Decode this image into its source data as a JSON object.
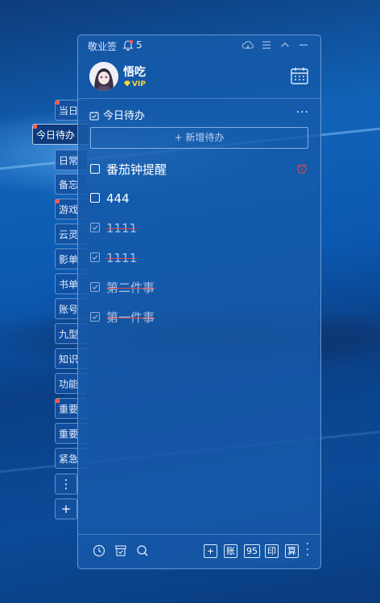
{
  "colors": {
    "accent": "#1f5fb0",
    "flag": "#ff5a4a",
    "strike": "#e0444b",
    "vip": "#ffd633"
  },
  "side_tabs": [
    {
      "label": "当日",
      "flag": true
    },
    {
      "label": "今日待办",
      "flag": true,
      "active": true
    },
    {
      "label": "日常",
      "flag": false
    },
    {
      "label": "备忘",
      "flag": false
    },
    {
      "label": "游戏",
      "flag": true
    },
    {
      "label": "云灵",
      "flag": false
    },
    {
      "label": "影单",
      "flag": false
    },
    {
      "label": "书单",
      "flag": false
    },
    {
      "label": "账号",
      "flag": false
    },
    {
      "label": "九型",
      "flag": false
    },
    {
      "label": "知识",
      "flag": false
    },
    {
      "label": "功能",
      "flag": false
    },
    {
      "label": "重要",
      "flag": true
    },
    {
      "label": "重要",
      "flag": false
    },
    {
      "label": "紧急",
      "flag": false
    }
  ],
  "side_buttons": {
    "more": "⋮",
    "add": "+"
  },
  "app": {
    "title": "敬业签",
    "notification_count": "5"
  },
  "titlebar_icons": [
    "cloud-sync-icon",
    "menu-icon",
    "collapse-icon",
    "minimize-icon"
  ],
  "user": {
    "name": "悟吃",
    "badge": "VIP"
  },
  "section": {
    "title": "今日待办",
    "more": "···"
  },
  "add_todo": {
    "label": "+ 新增待办"
  },
  "todos": [
    {
      "text": "番茄钟提醒",
      "done": false,
      "alarm": true
    },
    {
      "text": "444",
      "done": false,
      "alarm": false
    },
    {
      "text": "1111",
      "done": true,
      "alarm": false
    },
    {
      "text": "1111",
      "done": true,
      "alarm": false
    },
    {
      "text": "第二件事",
      "done": true,
      "alarm": false
    },
    {
      "text": "第一件事",
      "done": true,
      "alarm": false
    }
  ],
  "bottom_bar": {
    "left_icons": [
      "clock-icon",
      "archive-icon",
      "search-icon"
    ],
    "boxes": [
      "+",
      "账",
      "95",
      "印",
      "算"
    ],
    "more": "⋮"
  }
}
